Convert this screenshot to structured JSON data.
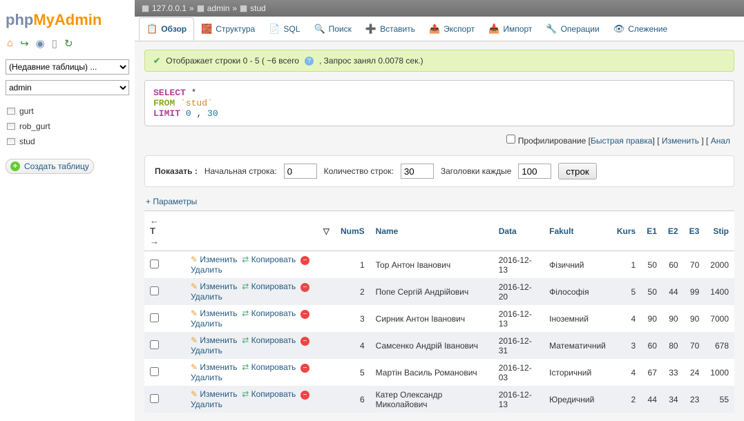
{
  "logo": {
    "p1": "php",
    "p2": "MyAdmin",
    "p3": ""
  },
  "breadcrumb": {
    "server": "127.0.0.1",
    "db": "admin",
    "table": "stud"
  },
  "sidebar": {
    "recent_placeholder": "(Недавние таблицы) ...",
    "db_selected": "admin",
    "tables": [
      "gurt",
      "rob_gurt",
      "stud"
    ],
    "create_label": "Создать таблицу"
  },
  "tabs": {
    "browse": "Обзор",
    "structure": "Структура",
    "sql": "SQL",
    "search": "Поиск",
    "insert": "Вставить",
    "export": "Экспорт",
    "import": "Импорт",
    "operations": "Операции",
    "tracking": "Слежение"
  },
  "status_text": "Отображает строки 0 - 5 ( ~6 всего",
  "status_text2": ", Запрос занял 0.0078 сек.)",
  "sql": {
    "select": "SELECT",
    "star": "*",
    "from": "FROM",
    "tbl": "`stud`",
    "limit": "LIMIT",
    "n1": "0",
    "n2": "30"
  },
  "profile": {
    "label": "Профилирование",
    "quick": "Быстрая правка",
    "edit": "Изменить",
    "analyze": "Анал"
  },
  "show": {
    "label": "Показать :",
    "start_label": "Начальная строка:",
    "start_value": "0",
    "rowcount_label": "Количество строк:",
    "rowcount_value": "30",
    "headers_label": "Заголовки каждые",
    "headers_value": "100",
    "rows_suffix": "строк"
  },
  "params_label": "+ Параметры",
  "headers": {
    "nums": "NumS",
    "name": "Name",
    "data": "Data",
    "fakult": "Fakult",
    "kurs": "Kurs",
    "e1": "E1",
    "e2": "E2",
    "e3": "E3",
    "stip": "Stip"
  },
  "actions": {
    "edit": "Изменить",
    "copy": "Копировать",
    "delete": "Удалить"
  },
  "rows": [
    {
      "nums": "1",
      "name": "Тор Антон Іванович",
      "data": "2016-12-13",
      "fakult": "Фізичний",
      "kurs": "1",
      "e1": "50",
      "e2": "60",
      "e3": "70",
      "stip": "2000"
    },
    {
      "nums": "2",
      "name": "Попе Сергій Андрійович",
      "data": "2016-12-20",
      "fakult": "Філософія",
      "kurs": "5",
      "e1": "50",
      "e2": "44",
      "e3": "99",
      "stip": "1400"
    },
    {
      "nums": "3",
      "name": "Сирник Антон Іванович",
      "data": "2016-12-13",
      "fakult": "Іноземний",
      "kurs": "4",
      "e1": "90",
      "e2": "90",
      "e3": "90",
      "stip": "7000"
    },
    {
      "nums": "4",
      "name": "Самсенко Андрій Іванович",
      "data": "2016-12-31",
      "fakult": "Математичний",
      "kurs": "3",
      "e1": "60",
      "e2": "80",
      "e3": "70",
      "stip": "678"
    },
    {
      "nums": "5",
      "name": "Мартін Василь Романович",
      "data": "2016-12-03",
      "fakult": "Історичний",
      "kurs": "4",
      "e1": "67",
      "e2": "33",
      "e3": "24",
      "stip": "1000"
    },
    {
      "nums": "6",
      "name": "Катер Олександр Миколайович",
      "data": "2016-12-13",
      "fakult": "Юредичний",
      "kurs": "2",
      "e1": "44",
      "e2": "34",
      "e3": "23",
      "stip": "55"
    }
  ]
}
